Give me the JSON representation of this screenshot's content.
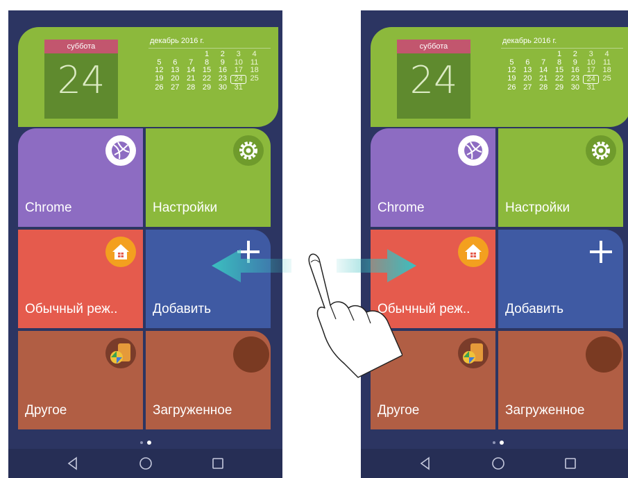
{
  "calendar": {
    "weekday": "суббота",
    "day": "24",
    "month_title": "декабрь 2016 г.",
    "weeks": [
      [
        "",
        "",
        "",
        "1",
        "2",
        "3",
        "4"
      ],
      [
        "5",
        "6",
        "7",
        "8",
        "9",
        "10",
        "11"
      ],
      [
        "12",
        "13",
        "14",
        "15",
        "16",
        "17",
        "18"
      ],
      [
        "19",
        "20",
        "21",
        "22",
        "23",
        "24",
        "25"
      ],
      [
        "26",
        "27",
        "28",
        "29",
        "30",
        "31",
        ""
      ]
    ]
  },
  "tiles": {
    "chrome": "Chrome",
    "settings": "Настройки",
    "normal_mode": "Обычный реж..",
    "add": "Добавить",
    "other": "Другое",
    "downloads": "Загруженное"
  },
  "colors": {
    "background": "#2c3562",
    "calendar": "#8cb93c",
    "chrome_tile": "#8d6cc2",
    "settings_tile": "#8cb93c",
    "normal_tile": "#e55b4d",
    "add_tile": "#3f5aa3",
    "other_tile": "#b15e44",
    "arrow": "#3bbfc0"
  },
  "icons": [
    "chrome-icon",
    "gear-icon",
    "home-icon",
    "plus-icon",
    "gallery-icon",
    "downloads-icon",
    "back-icon",
    "home-nav-icon",
    "recent-apps-icon",
    "swipe-arrow-icon",
    "hand-gesture-icon"
  ]
}
